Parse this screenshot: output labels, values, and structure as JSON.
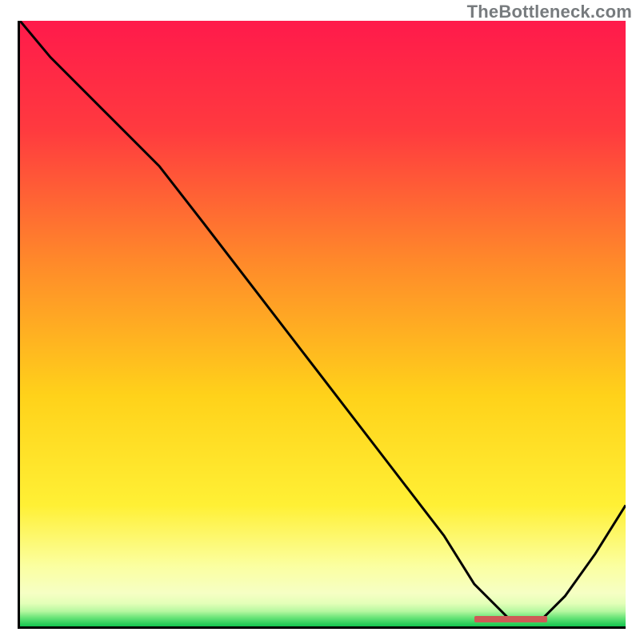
{
  "watermark": "TheBottleneck.com",
  "chart_data": {
    "type": "line",
    "title": "",
    "xlabel": "",
    "ylabel": "",
    "xlim": [
      0,
      100
    ],
    "ylim": [
      0,
      100
    ],
    "gradient_stops": [
      {
        "offset": 0,
        "color": "#ff1a4b"
      },
      {
        "offset": 0.18,
        "color": "#ff3a3f"
      },
      {
        "offset": 0.4,
        "color": "#ff8a2a"
      },
      {
        "offset": 0.62,
        "color": "#ffd21a"
      },
      {
        "offset": 0.8,
        "color": "#fff035"
      },
      {
        "offset": 0.9,
        "color": "#fbffa0"
      },
      {
        "offset": 0.945,
        "color": "#f6ffc4"
      },
      {
        "offset": 0.962,
        "color": "#e4ffb8"
      },
      {
        "offset": 0.975,
        "color": "#b6f8a0"
      },
      {
        "offset": 0.985,
        "color": "#6de57a"
      },
      {
        "offset": 1.0,
        "color": "#13c54f"
      }
    ],
    "series": [
      {
        "name": "bottleneck-curve",
        "x": [
          0,
          5,
          15,
          23,
          30,
          40,
          50,
          60,
          70,
          75,
          81,
          86,
          90,
          95,
          100
        ],
        "y": [
          100,
          94,
          84,
          76,
          67,
          54,
          41,
          28,
          15,
          7,
          1,
          1,
          5,
          12,
          20
        ]
      }
    ],
    "marker": {
      "x_start": 75,
      "x_end": 87,
      "y": 1.2,
      "color": "#cf5a56"
    },
    "legend": []
  }
}
